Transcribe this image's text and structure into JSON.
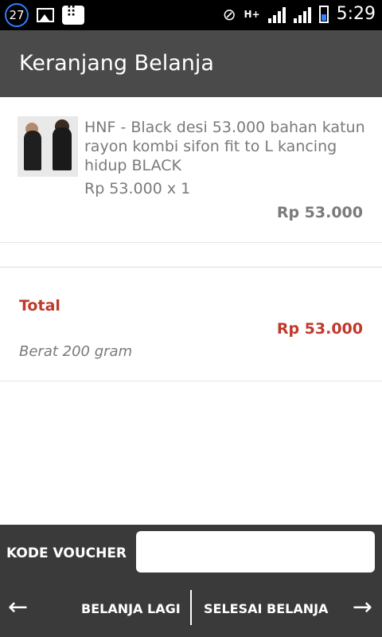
{
  "statusbar": {
    "notification_count": "27",
    "network_type": "H+",
    "time": "5:29"
  },
  "header": {
    "title": "Keranjang Belanja"
  },
  "cart": {
    "items": [
      {
        "name": "HNF - Black desi 53.000 bahan katun rayon kombi sifon fit to L kancing hidup  BLACK",
        "price_qty": "Rp 53.000 x 1",
        "subtotal": "Rp 53.000"
      }
    ],
    "total_label": "Total",
    "total_value": "Rp 53.000",
    "weight": "Berat 200 gram"
  },
  "voucher": {
    "label": "KODE VOUCHER",
    "value": ""
  },
  "nav": {
    "back_label": "BELANJA LAGI",
    "finish_label": "SELESAI BELANJA"
  },
  "colors": {
    "header_bg": "#4a4a4a",
    "bottom_bg": "#3a3a3a",
    "accent_red": "#c0392b",
    "text_gray": "#7a7a7a"
  }
}
